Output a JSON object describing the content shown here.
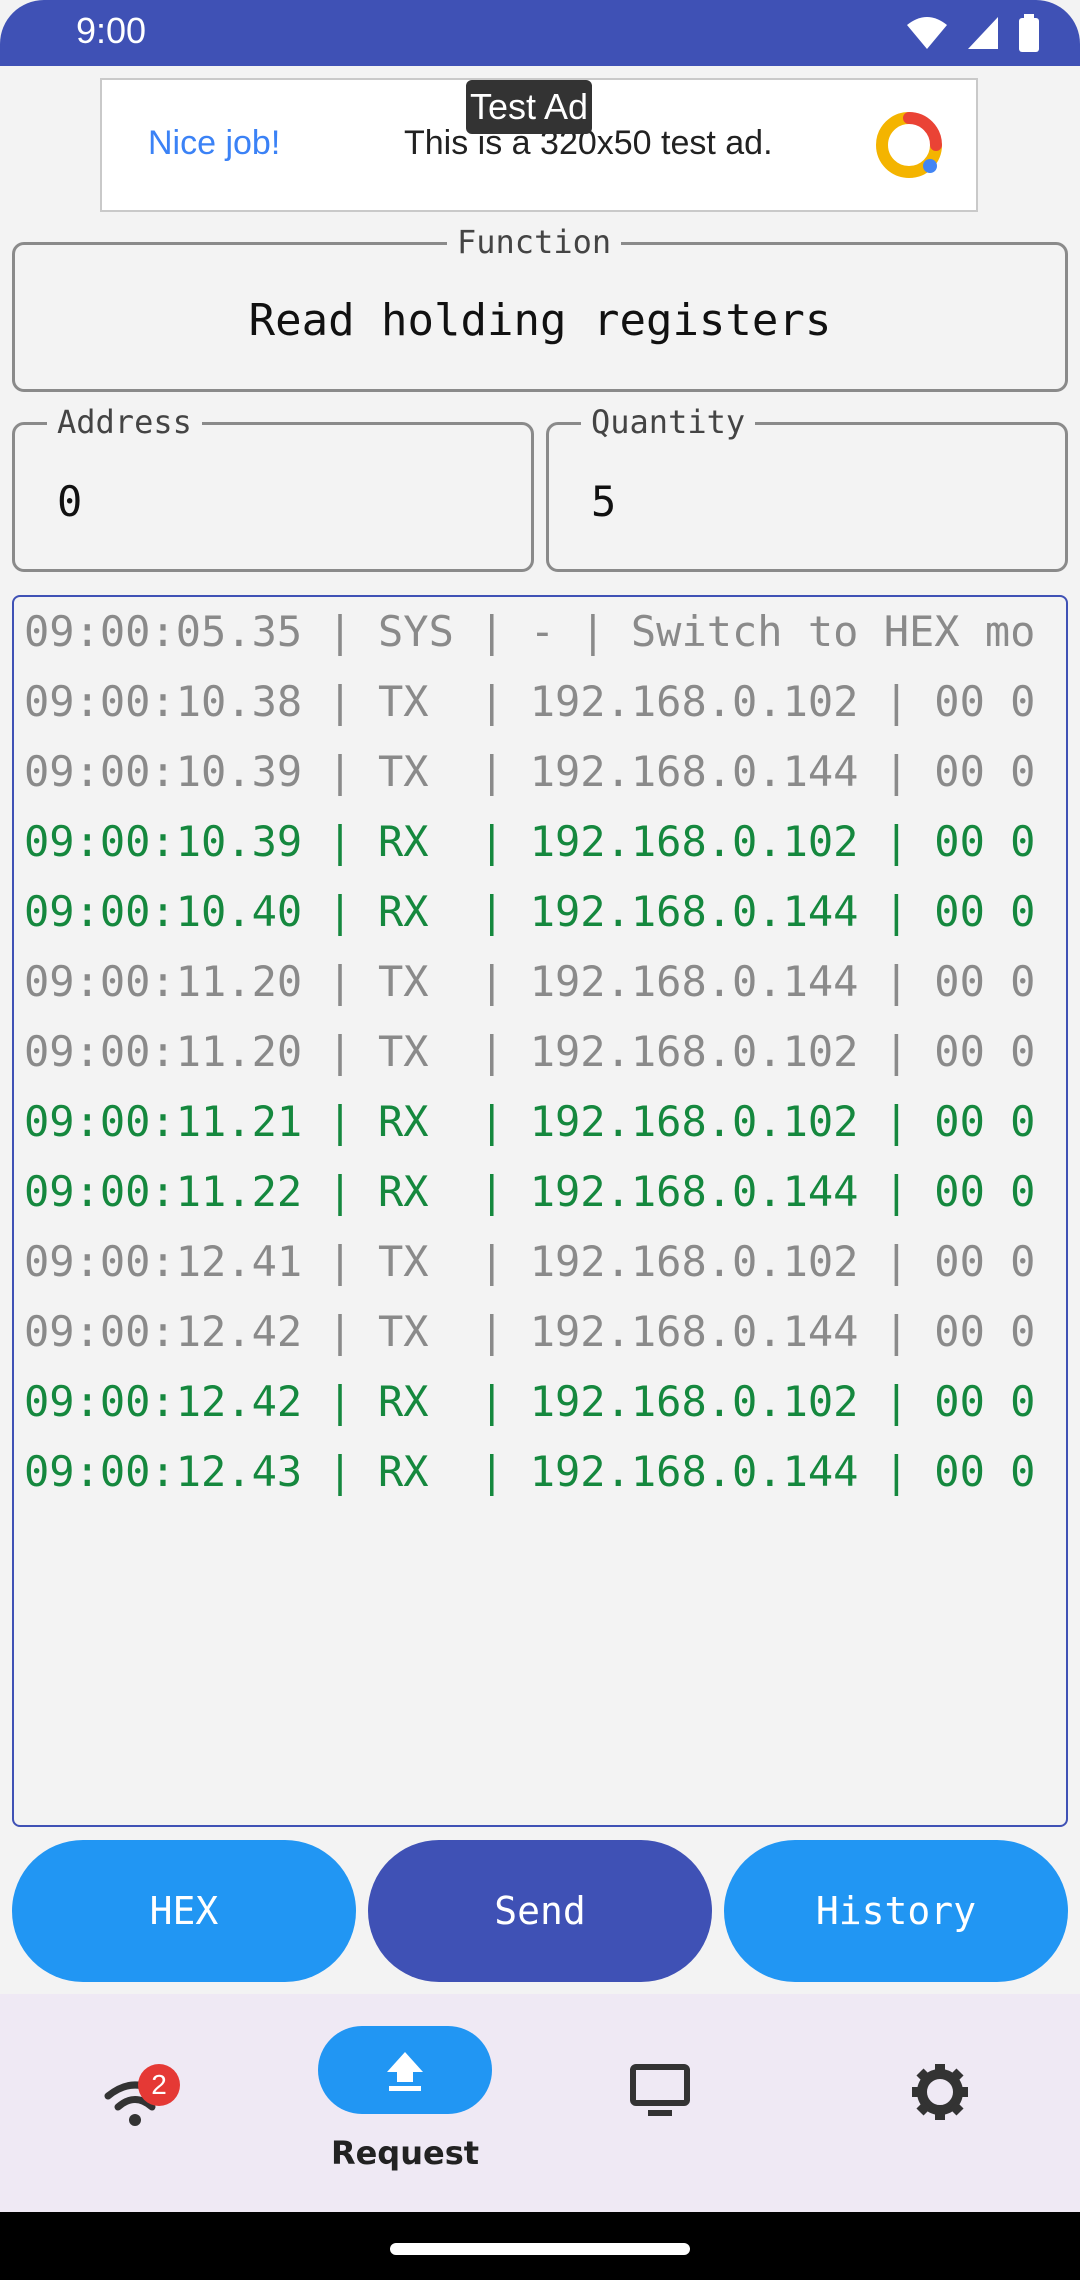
{
  "status_bar": {
    "time": "9:00"
  },
  "ad": {
    "badge": "Test Ad",
    "headline": "Nice job!",
    "text": "This is a 320x50 test ad."
  },
  "function_field": {
    "label": "Function",
    "value": "Read holding registers"
  },
  "address_field": {
    "label": "Address",
    "value": "0"
  },
  "quantity_field": {
    "label": "Quantity",
    "value": "5"
  },
  "log": [
    {
      "kind": "sys",
      "text": "09:00:05.35 | SYS | - | Switch to HEX mo"
    },
    {
      "kind": "tx",
      "text": "09:00:10.38 | TX  | 192.168.0.102 | 00 0"
    },
    {
      "kind": "tx",
      "text": "09:00:10.39 | TX  | 192.168.0.144 | 00 0"
    },
    {
      "kind": "rx",
      "text": "09:00:10.39 | RX  | 192.168.0.102 | 00 0"
    },
    {
      "kind": "rx",
      "text": "09:00:10.40 | RX  | 192.168.0.144 | 00 0"
    },
    {
      "kind": "tx",
      "text": "09:00:11.20 | TX  | 192.168.0.144 | 00 0"
    },
    {
      "kind": "tx",
      "text": "09:00:11.20 | TX  | 192.168.0.102 | 00 0"
    },
    {
      "kind": "rx",
      "text": "09:00:11.21 | RX  | 192.168.0.102 | 00 0"
    },
    {
      "kind": "rx",
      "text": "09:00:11.22 | RX  | 192.168.0.144 | 00 0"
    },
    {
      "kind": "tx",
      "text": "09:00:12.41 | TX  | 192.168.0.102 | 00 0"
    },
    {
      "kind": "tx",
      "text": "09:00:12.42 | TX  | 192.168.0.144 | 00 0"
    },
    {
      "kind": "rx",
      "text": "09:00:12.42 | RX  | 192.168.0.102 | 00 0"
    },
    {
      "kind": "rx",
      "text": "09:00:12.43 | RX  | 192.168.0.144 | 00 0"
    }
  ],
  "buttons": {
    "hex": "HEX",
    "send": "Send",
    "history": "History"
  },
  "bottom_nav": {
    "wifi_badge": "2",
    "request_label": "Request"
  },
  "colors": {
    "primary": "#3f51b5",
    "accent": "#2196f3",
    "rx": "#15883e",
    "tx": "#8a8a8a"
  }
}
